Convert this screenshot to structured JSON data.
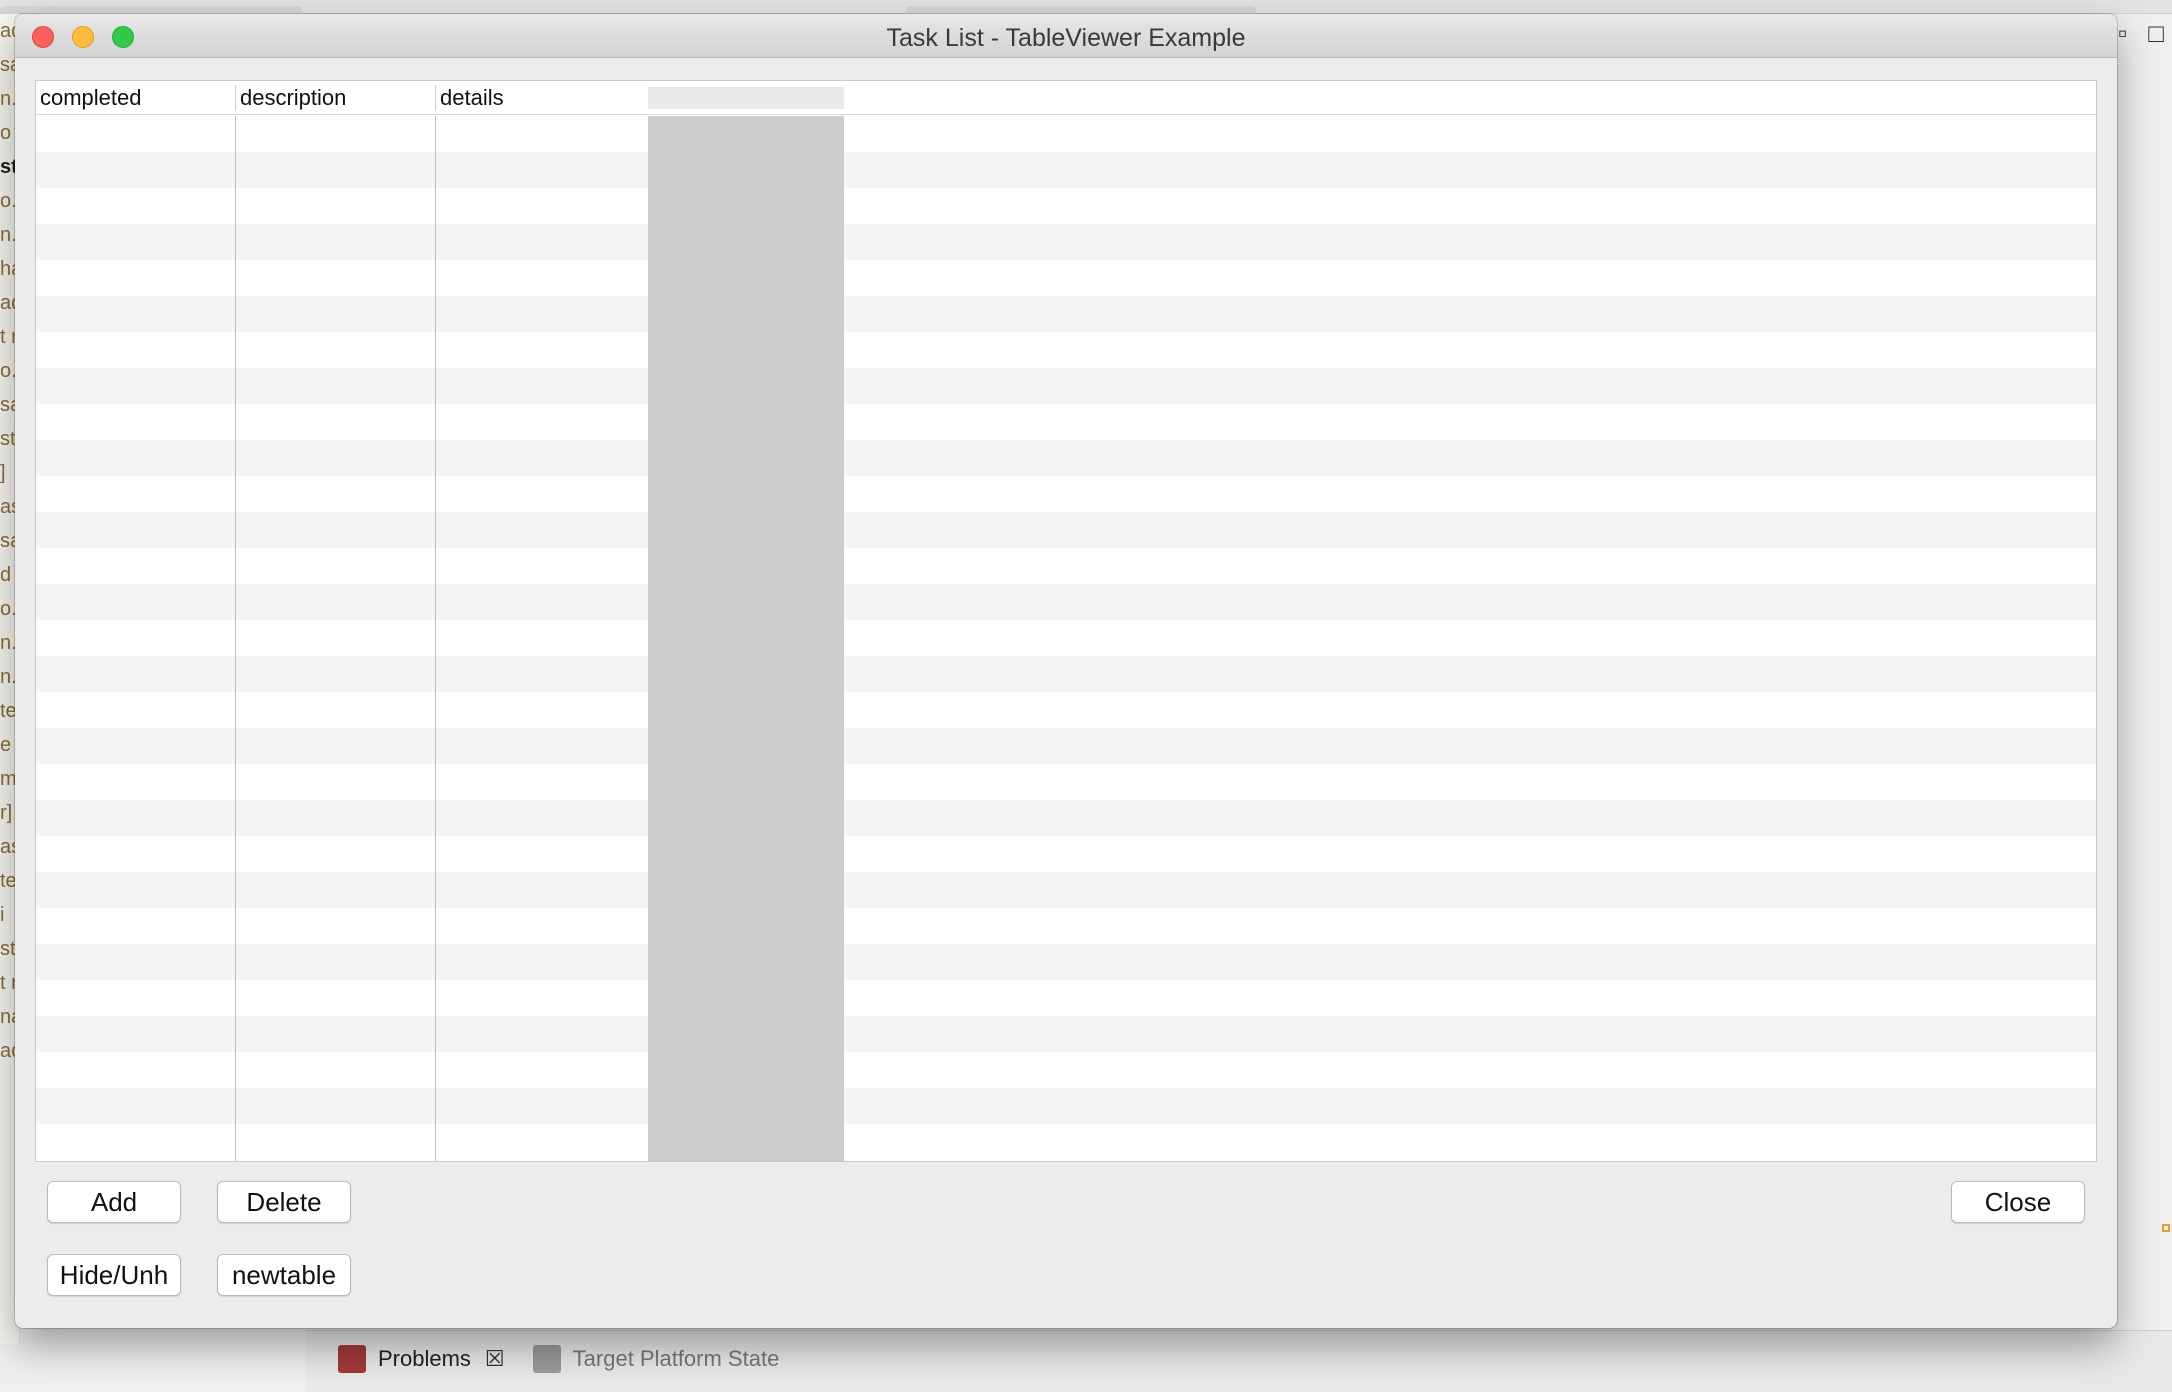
{
  "window": {
    "title": "Task List - TableViewer Example"
  },
  "table": {
    "columns": [
      "completed",
      "description",
      "details"
    ],
    "row_count": 29
  },
  "buttons": {
    "add": "Add",
    "delete": "Delete",
    "close": "Close",
    "hide_unhide": "Hide/Unh",
    "newtable": "newtable"
  },
  "background": {
    "editor_fragments": [
      "ad",
      "sa",
      "n.",
      "o",
      "st",
      "o.a",
      "n.",
      "ha",
      "ad",
      "t r",
      "o.",
      "sa",
      "ste",
      "]",
      "as",
      "sa",
      "d",
      "o.a",
      "n.",
      "n.s",
      "te",
      "e",
      "m",
      "r]",
      "as",
      "te",
      "i",
      "st",
      "t r",
      "na",
      "ac"
    ],
    "bottom_tabs": [
      {
        "label": "Problems",
        "icon": "problems-icon"
      },
      {
        "label": "Target Platform State",
        "icon": "target-platform-icon"
      }
    ]
  },
  "colors": {
    "close": "#fc605c",
    "minimize": "#fdbc40",
    "maximize": "#34c84a",
    "selected_column": "#cccccc"
  }
}
